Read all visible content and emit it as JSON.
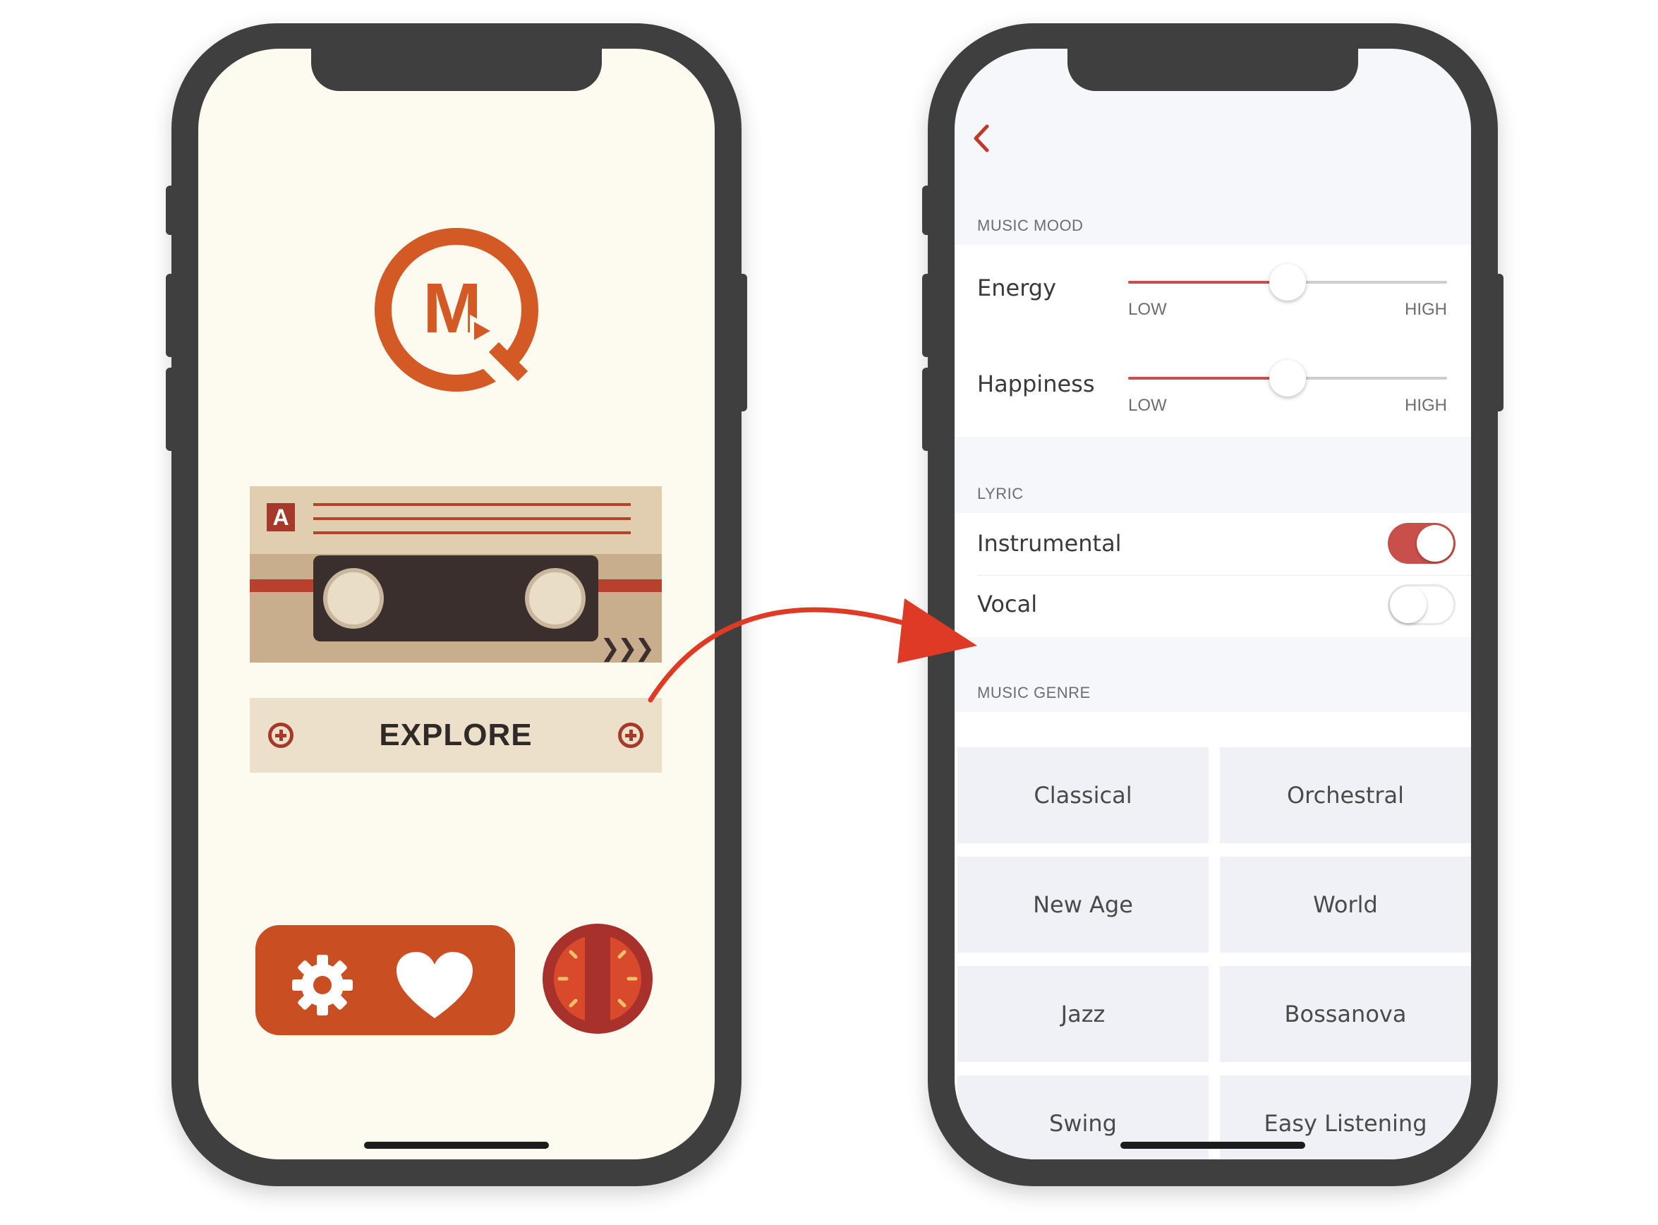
{
  "home_screen": {
    "logo_letter": "M",
    "cassette": {
      "side_label": "A",
      "forward_arrows": "❯❯❯"
    },
    "explore_button": {
      "label": "EXPLORE"
    },
    "actions": {
      "settings_icon": "gear-icon",
      "favorites_icon": "heart-icon",
      "timer_icon": "tomato-timer-icon"
    }
  },
  "filter_screen": {
    "back_icon": "chevron-left-icon",
    "music_mood": {
      "header": "MUSIC MOOD",
      "sliders": [
        {
          "label": "Energy",
          "min_label": "LOW",
          "max_label": "HIGH",
          "value": 0.5
        },
        {
          "label": "Happiness",
          "min_label": "LOW",
          "max_label": "HIGH",
          "value": 0.5
        }
      ]
    },
    "lyric": {
      "header": "LYRIC",
      "toggles": [
        {
          "label": "Instrumental",
          "on": true
        },
        {
          "label": "Vocal",
          "on": false
        }
      ]
    },
    "music_genre": {
      "header": "MUSIC GENRE",
      "genres": [
        "Classical",
        "Orchestral",
        "New Age",
        "World",
        "Jazz",
        "Bossanova",
        "Swing",
        "Easy Listening"
      ]
    }
  },
  "colors": {
    "brand_orange": "#d35a24",
    "accent_red": "#c9504a",
    "arrow_red": "#de3a26",
    "phone_frame": "#3f3f3f",
    "home_background": "#fdfbef",
    "filter_background": "#f6f7fb"
  }
}
